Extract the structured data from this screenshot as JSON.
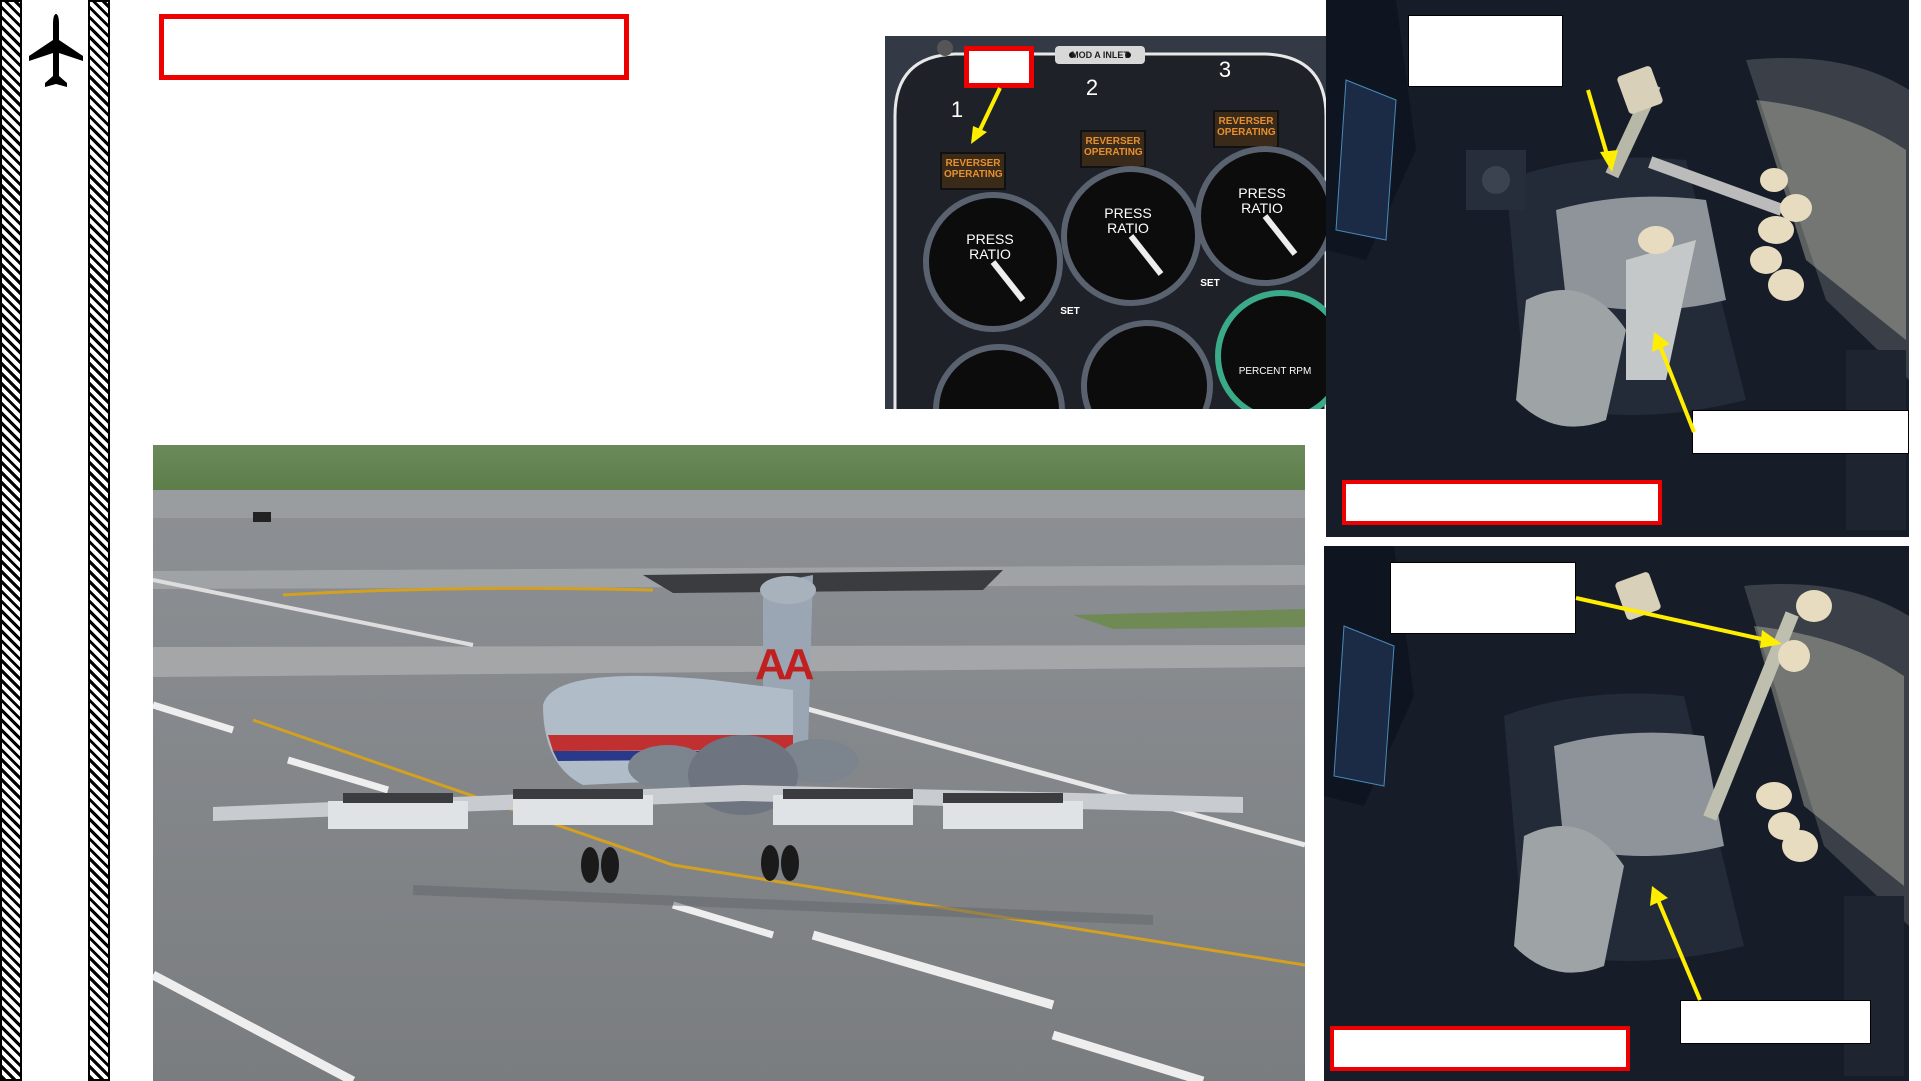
{
  "sidebar": {
    "icon": "airplane-icon"
  },
  "callouts": {
    "main_title": "",
    "panel_number": "",
    "reverser_caption": "",
    "throttle_top_caption": "",
    "throttle_top_lower_caption": "",
    "throttle_bottom_caption": "",
    "throttle_bottom_lower_caption": "",
    "throttle_bottom_red_caption": ""
  },
  "instrument_panel": {
    "placard": "MOD A INLET",
    "engine_numbers": [
      "1",
      "2",
      "3"
    ],
    "annunciator": "REVERSER OPERATING",
    "gauge_label_line1": "PRESS",
    "gauge_label_line2": "RATIO",
    "set_label": "SET",
    "rpm_label": "PERCENT RPM"
  },
  "aircraft": {
    "tail_logo": "AA"
  },
  "colors": {
    "callout_red": "#e00000",
    "arrow_yellow": "#ffee00",
    "annunciator_amber": "#e89030"
  }
}
